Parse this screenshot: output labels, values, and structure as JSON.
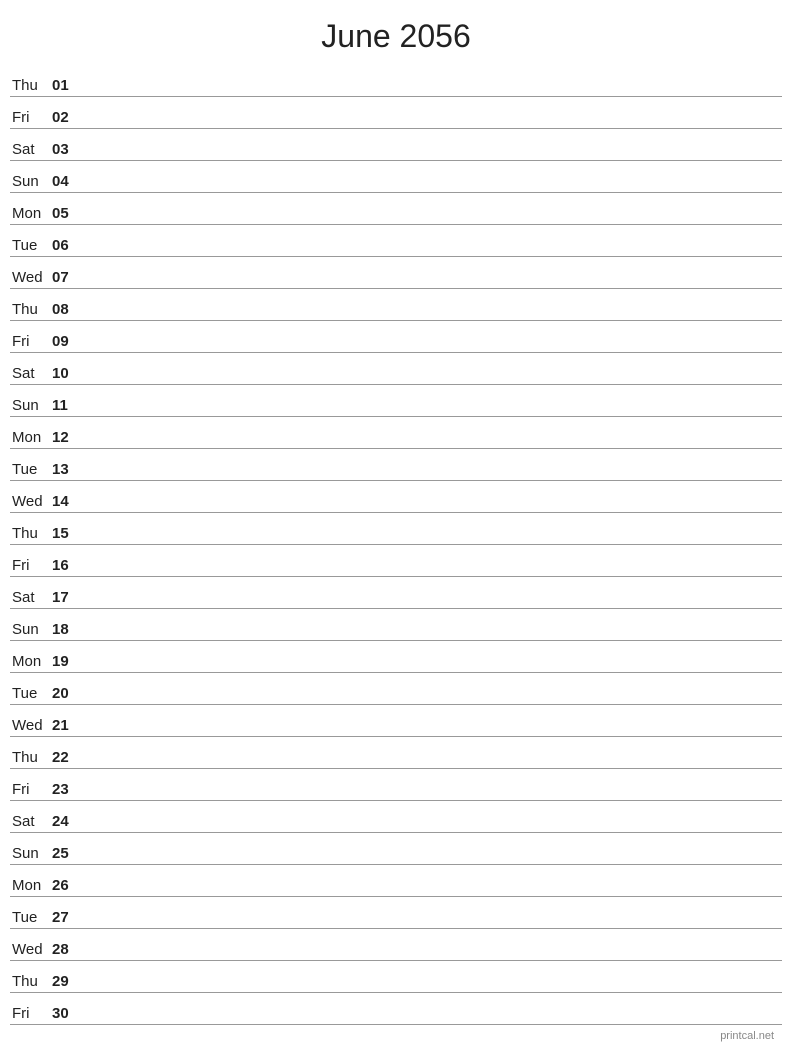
{
  "title": "June 2056",
  "footer": "printcal.net",
  "days": [
    {
      "name": "Thu",
      "num": "01"
    },
    {
      "name": "Fri",
      "num": "02"
    },
    {
      "name": "Sat",
      "num": "03"
    },
    {
      "name": "Sun",
      "num": "04"
    },
    {
      "name": "Mon",
      "num": "05"
    },
    {
      "name": "Tue",
      "num": "06"
    },
    {
      "name": "Wed",
      "num": "07"
    },
    {
      "name": "Thu",
      "num": "08"
    },
    {
      "name": "Fri",
      "num": "09"
    },
    {
      "name": "Sat",
      "num": "10"
    },
    {
      "name": "Sun",
      "num": "11"
    },
    {
      "name": "Mon",
      "num": "12"
    },
    {
      "name": "Tue",
      "num": "13"
    },
    {
      "name": "Wed",
      "num": "14"
    },
    {
      "name": "Thu",
      "num": "15"
    },
    {
      "name": "Fri",
      "num": "16"
    },
    {
      "name": "Sat",
      "num": "17"
    },
    {
      "name": "Sun",
      "num": "18"
    },
    {
      "name": "Mon",
      "num": "19"
    },
    {
      "name": "Tue",
      "num": "20"
    },
    {
      "name": "Wed",
      "num": "21"
    },
    {
      "name": "Thu",
      "num": "22"
    },
    {
      "name": "Fri",
      "num": "23"
    },
    {
      "name": "Sat",
      "num": "24"
    },
    {
      "name": "Sun",
      "num": "25"
    },
    {
      "name": "Mon",
      "num": "26"
    },
    {
      "name": "Tue",
      "num": "27"
    },
    {
      "name": "Wed",
      "num": "28"
    },
    {
      "name": "Thu",
      "num": "29"
    },
    {
      "name": "Fri",
      "num": "30"
    }
  ]
}
